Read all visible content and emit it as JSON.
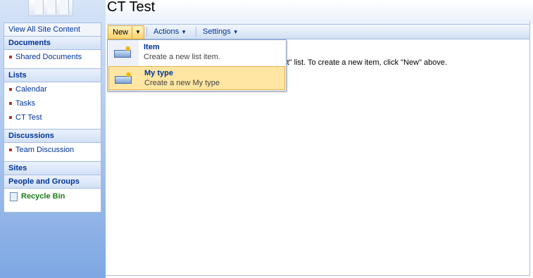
{
  "page": {
    "title": "CT Test"
  },
  "quick_launch": {
    "view_all": "View All Site Content",
    "sections": [
      {
        "heading": "Documents",
        "items": [
          "Shared Documents"
        ]
      },
      {
        "heading": "Lists",
        "items": [
          "Calendar",
          "Tasks",
          "CT Test"
        ]
      },
      {
        "heading": "Discussions",
        "items": [
          "Team Discussion"
        ]
      },
      {
        "heading": "Sites",
        "items": []
      },
      {
        "heading": "People and Groups",
        "items": []
      }
    ],
    "recycle_bin": "Recycle Bin"
  },
  "toolbar": {
    "new_label": "New",
    "actions_label": "Actions",
    "settings_label": "Settings"
  },
  "content": {
    "message": "est\" list. To create a new item, click \"New\" above."
  },
  "new_menu": {
    "items": [
      {
        "title": "Item",
        "description": "Create a new list item.",
        "selected": false
      },
      {
        "title": "My type",
        "description": "Create a new My type",
        "selected": true
      }
    ]
  },
  "colors": {
    "link": "#003399",
    "highlight": "#ffe6a2",
    "recycle": "#1a7f1a"
  }
}
